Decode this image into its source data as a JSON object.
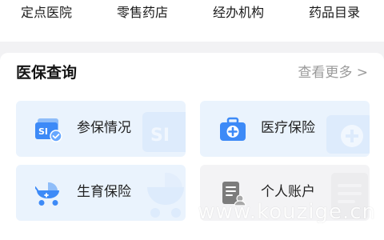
{
  "top_nav": {
    "items": [
      "定点医院",
      "零售药店",
      "经办机构",
      "药品目录"
    ]
  },
  "insurance_query": {
    "title": "医保查询",
    "more_label": "查看更多 >",
    "tiles": [
      {
        "label": "参保情况",
        "icon": "insurance-card-icon",
        "color": "#3d8af7"
      },
      {
        "label": "医疗保险",
        "icon": "medical-kit-icon",
        "color": "#3d8af7"
      },
      {
        "label": "生育保险",
        "icon": "baby-stroller-icon",
        "color": "#3d8af7"
      },
      {
        "label": "个人账户",
        "icon": "personal-account-document-icon",
        "color": "#555555"
      }
    ]
  },
  "watermark": "www.kouzige.cn",
  "colors": {
    "accent": "#3d8af7",
    "tile_blue_bg": "#eaf3fd",
    "tile_grey_bg": "#f3f3f5",
    "page_bg": "#f2f2f4"
  }
}
